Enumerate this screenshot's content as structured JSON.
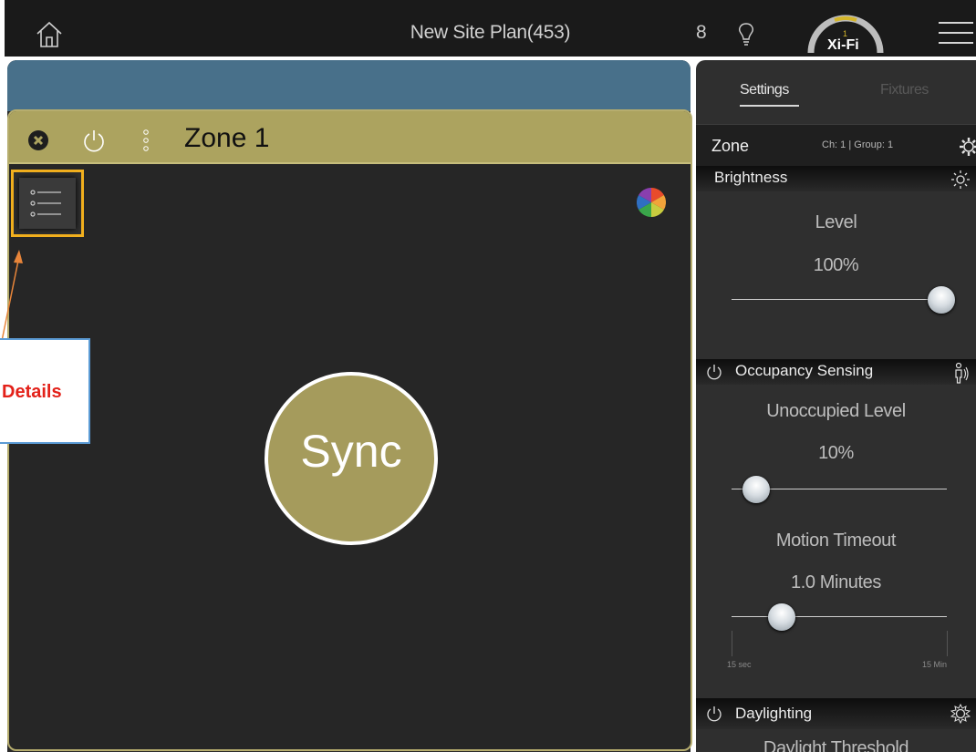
{
  "topbar": {
    "title": "New Site Plan(453)",
    "count": "8",
    "logo_text": "Xi-Fi",
    "logo_mark": "1"
  },
  "zone_panel": {
    "title": "Zone 1",
    "sync_label": "Sync"
  },
  "callout": {
    "label": "Details"
  },
  "settings": {
    "tabs": [
      {
        "label": "Settings",
        "active": true
      },
      {
        "label": "Fixtures",
        "active": false
      }
    ],
    "zone_row": {
      "label": "Zone",
      "meta": "Ch: 1 | Group: 1"
    },
    "brightness": {
      "title": "Brightness",
      "level_label": "Level",
      "level_value": "100%",
      "slider_fraction": 1.0
    },
    "occupancy": {
      "title": "Occupancy Sensing",
      "unoccupied_label": "Unoccupied Level",
      "unoccupied_value": "10%",
      "unoccupied_fraction": 0.1,
      "timeout_label": "Motion Timeout",
      "timeout_value": "1.0 Minutes",
      "timeout_fraction": 0.24,
      "range_min": "15 sec",
      "range_max": "15 Min"
    },
    "daylighting": {
      "title": "Daylighting",
      "threshold_label": "Daylight Threshold"
    }
  },
  "colors": {
    "accent_gold": "#aca35f",
    "strip_blue": "#48708a",
    "highlight": "#f2b01e",
    "callout_text": "#e32119"
  }
}
